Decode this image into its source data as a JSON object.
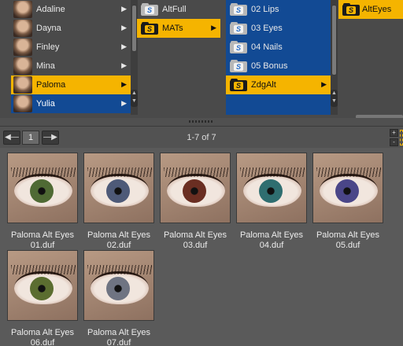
{
  "characters": [
    {
      "label": "Adaline"
    },
    {
      "label": "Dayna"
    },
    {
      "label": "Finley"
    },
    {
      "label": "Mina"
    },
    {
      "label": "Paloma"
    },
    {
      "label": "Yulia"
    }
  ],
  "subfolders": [
    {
      "label": "AltFull"
    },
    {
      "label": "MATs"
    }
  ],
  "mats": [
    {
      "label": "02 Lips"
    },
    {
      "label": "03 Eyes"
    },
    {
      "label": "04 Nails"
    },
    {
      "label": "05 Bonus"
    },
    {
      "label": "ZdgAlt"
    }
  ],
  "alt": [
    {
      "label": "AltEyes"
    }
  ],
  "toolbar": {
    "page_number": "1",
    "page_info": "1-7 of 7",
    "prev_icon": "left-arrow-icon",
    "next_icon": "right-arrow-icon"
  },
  "items": [
    {
      "line1": "Paloma Alt Eyes",
      "line2": "01.duf",
      "iris": "#4f6a34"
    },
    {
      "line1": "Paloma Alt Eyes",
      "line2": "02.duf",
      "iris": "#4e5a78"
    },
    {
      "line1": "Paloma Alt Eyes",
      "line2": "03.duf",
      "iris": "#6a2e22"
    },
    {
      "line1": "Paloma Alt Eyes",
      "line2": "04.duf",
      "iris": "#2f6e70"
    },
    {
      "line1": "Paloma Alt Eyes",
      "line2": "05.duf",
      "iris": "#4a4688"
    },
    {
      "line1": "Paloma Alt Eyes",
      "line2": "06.duf",
      "iris": "#5b6d30"
    },
    {
      "line1": "Paloma Alt Eyes",
      "line2": "07.duf",
      "iris": "#6f7482"
    }
  ],
  "colors": {
    "selection": "#f5b400",
    "selection_blue": "#124a94",
    "panel": "#5a5a5a"
  }
}
